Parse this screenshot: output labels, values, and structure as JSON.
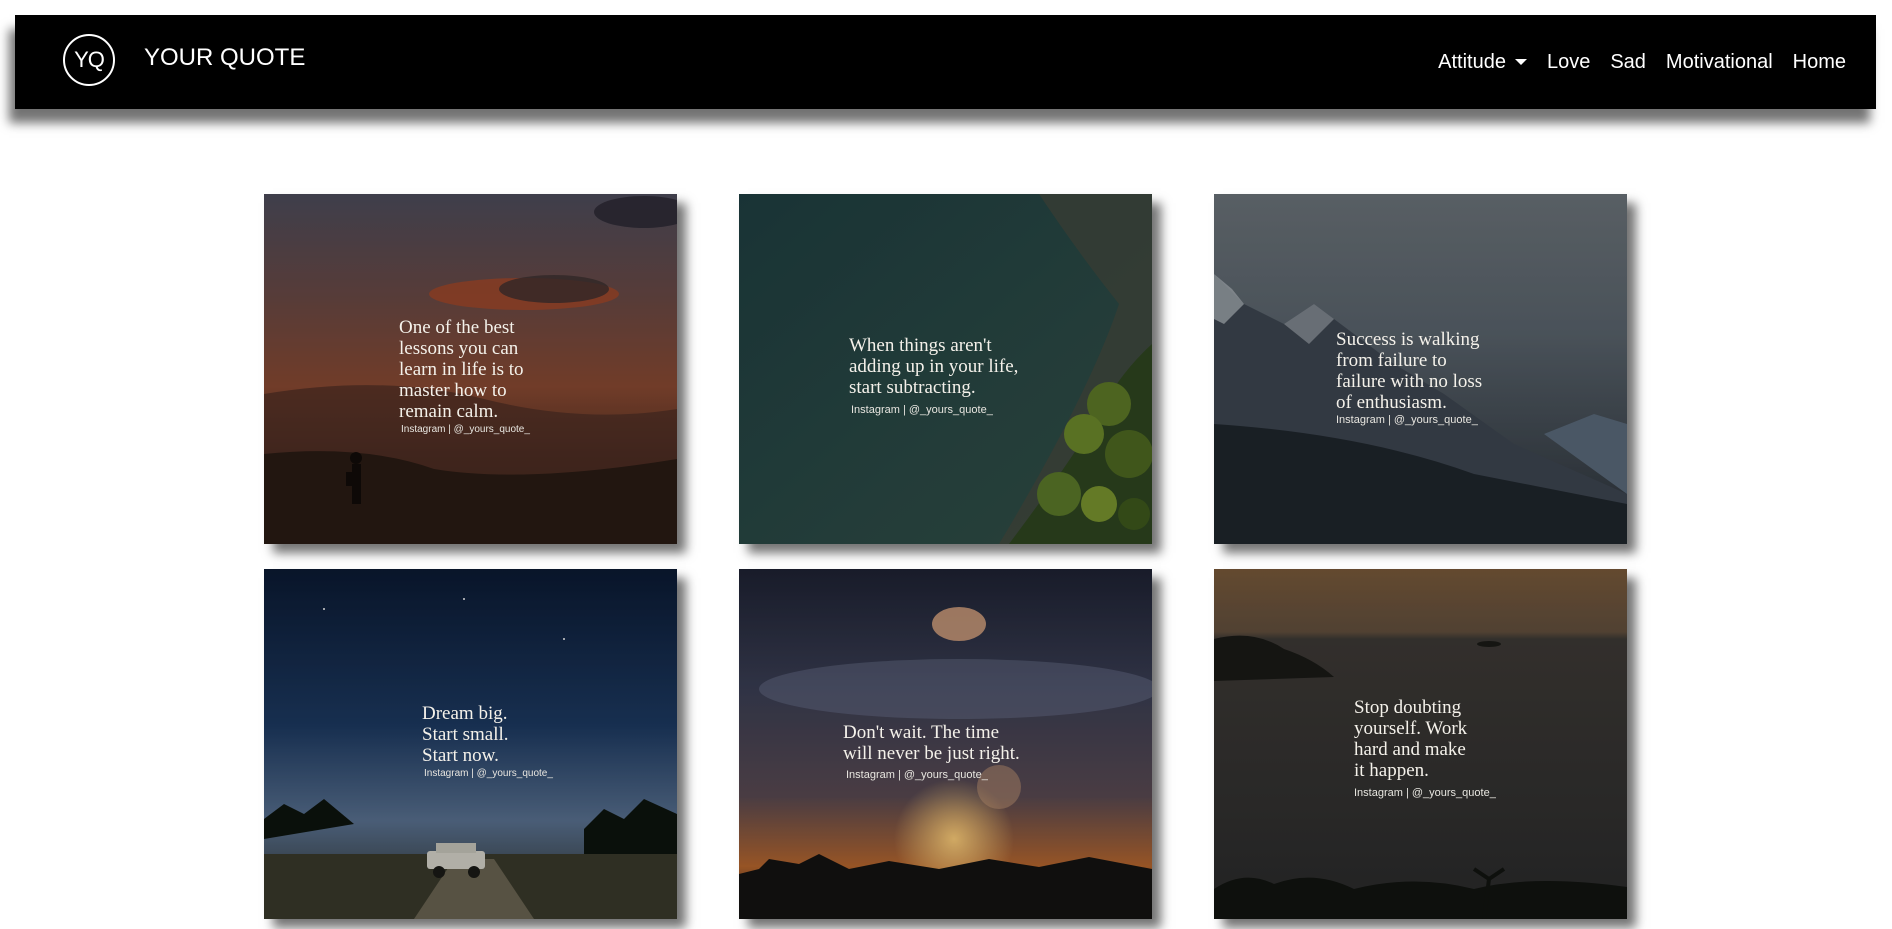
{
  "header": {
    "logo_text": "YQ",
    "brand": "YOUR QUOTE",
    "nav": [
      {
        "label": "Attitude",
        "has_dropdown": true
      },
      {
        "label": "Love"
      },
      {
        "label": "Sad"
      },
      {
        "label": "Motivational"
      },
      {
        "label": "Home"
      }
    ]
  },
  "cards": [
    {
      "quote": "One of the best\nlessons you can\nlearn in life is to\nmaster how to\nremain calm.",
      "credit": "Instagram | @_yours_quote_"
    },
    {
      "quote": "When things aren't\nadding up in your life,\nstart subtracting.",
      "credit": "Instagram | @_yours_quote_"
    },
    {
      "quote": "Success is walking\nfrom failure to\nfailure with no loss\nof enthusiasm.",
      "credit": "Instagram | @_yours_quote_"
    },
    {
      "quote": "Dream big.\nStart small.\nStart now.",
      "credit": "Instagram | @_yours_quote_"
    },
    {
      "quote": "Don't wait. The time\nwill never be just right.",
      "credit": "Instagram | @_yours_quote_"
    },
    {
      "quote": "Stop doubting\nyourself. Work\nhard and make\nit happen.",
      "credit": "Instagram | @_yours_quote_"
    }
  ],
  "colors": {
    "navbar": "#000000",
    "text": "#ffffff"
  }
}
